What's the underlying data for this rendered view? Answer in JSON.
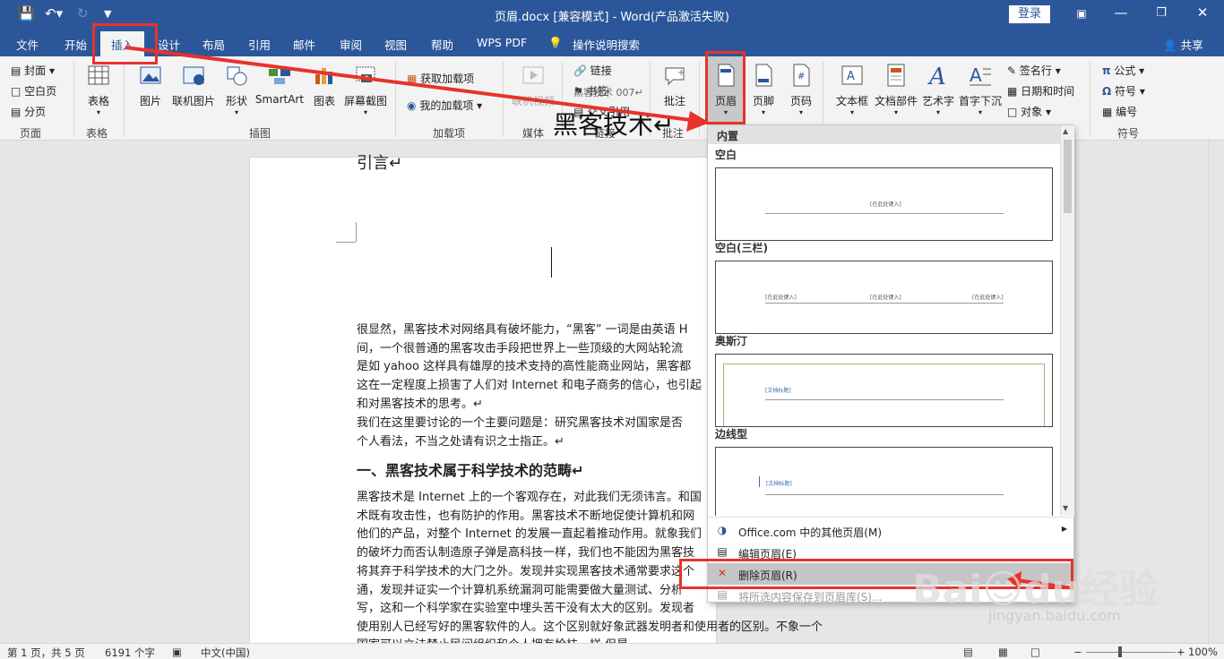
{
  "window": {
    "title": "页眉.docx [兼容模式]  -  Word(产品激活失败)",
    "login": "登录",
    "share": "共享"
  },
  "tabs": [
    "文件",
    "开始",
    "插入",
    "设计",
    "布局",
    "引用",
    "邮件",
    "审阅",
    "视图",
    "帮助",
    "WPS PDF",
    "操作说明搜索"
  ],
  "ribbon": {
    "page_group": {
      "items": [
        "封面",
        "空白页",
        "分页"
      ],
      "label": "页面"
    },
    "table": {
      "button": "表格",
      "label": "表格"
    },
    "illustrations": {
      "items": [
        "图片",
        "联机图片",
        "形状",
        "SmartArt",
        "图表",
        "屏幕截图"
      ],
      "label": "插图"
    },
    "addins": {
      "items": [
        "获取加载项",
        "我的加载项"
      ],
      "label": "加载项"
    },
    "media": {
      "button": "联机视频",
      "label": "媒体"
    },
    "links": {
      "items": [
        "链接",
        "书签",
        "交叉引用"
      ],
      "label": "链接"
    },
    "comments": {
      "button": "批注",
      "label": "批注"
    },
    "header_footer": {
      "items": [
        "页眉",
        "页脚",
        "页码"
      ]
    },
    "text": {
      "items": [
        "文本框",
        "文档部件",
        "艺术字",
        "首字下沉",
        "签名行",
        "日期和时间",
        "对象"
      ]
    },
    "symbols": {
      "items": [
        "公式",
        "符号",
        "编号"
      ],
      "label": "符号"
    }
  },
  "document": {
    "header_text": "黑客技术 007↵",
    "title": "黑客技术↵",
    "intro_heading": "引言↵",
    "para1": [
      "很显然，黑客技术对网络具有破坏能力，“黑客” 一词是由英语 H",
      "间，一个很普通的黑客攻击手段把世界上一些顶级的大网站轮流",
      "是如 yahoo 这样具有雄厚的技术支持的高性能商业网站，黑客都",
      "这在一定程度上损害了人们对 Internet 和电子商务的信心，也引起",
      "和对黑客技术的思考。↵",
      "我们在这里要讨论的一个主要问题是：研究黑客技术对国家是否",
      "个人看法，不当之处请有识之士指正。↵"
    ],
    "section_heading": "一、黑客技术属于科学技术的范畴↵",
    "para2": [
      "黑客技术是 Internet 上的一个客观存在，对此我们无须讳言。和国",
      "术既有攻击性，也有防护的作用。黑客技术不断地促使计算机和网",
      "他们的产品，对整个 Internet 的发展一直起着推动作用。就象我们",
      "的破坏力而否认制造原子弹是高科技一样，我们也不能因为黑客技",
      "将其弃于科学技术的大门之外。发现并实现黑客技术通常要求这个",
      "通，发现并证实一个计算机系统漏洞可能需要做大量测试、分析",
      "写，这和一个科学家在实验室中埋头苦干没有太大的区别。发现者",
      "使用别人已经写好的黑客软件的人。这个区别就好象武器发明者和使用者的区别。不象一个",
      "国家可以立法禁止民间组织和个人拥有枪枝一样 但是..."
    ]
  },
  "dropdown": {
    "header": "内置",
    "sections": [
      {
        "name": "空白",
        "placeholders": [
          "[在此处键入]"
        ]
      },
      {
        "name": "空白(三栏)",
        "placeholders": [
          "[在此处键入]",
          "[在此处键入]",
          "[在此处键入]"
        ]
      },
      {
        "name": "奥斯汀",
        "placeholders": [
          "[文档标题]"
        ]
      },
      {
        "name": "边线型",
        "placeholders": [
          "[文档标题]"
        ]
      }
    ],
    "menu": [
      {
        "label": "Office.com 中的其他页眉(M)",
        "icon": "globe-icon"
      },
      {
        "label": "编辑页眉(E)",
        "icon": "edit-header-icon"
      },
      {
        "label": "删除页眉(R)",
        "icon": "delete-header-icon"
      },
      {
        "label": "将所选内容保存到页眉库(S)...",
        "icon": "save-gallery-icon"
      }
    ]
  },
  "statusbar": {
    "page": "第 1 页，共 5 页",
    "words": "6191 个字",
    "language": "中文(中国)",
    "zoom": "100%"
  },
  "watermark": {
    "brand": "Bai☺du经验",
    "url": "jingyan.baidu.com"
  },
  "colors": {
    "brand": "#2b579a",
    "annotation": "#e8322b",
    "menu_highlight": "#c5c5c5"
  }
}
